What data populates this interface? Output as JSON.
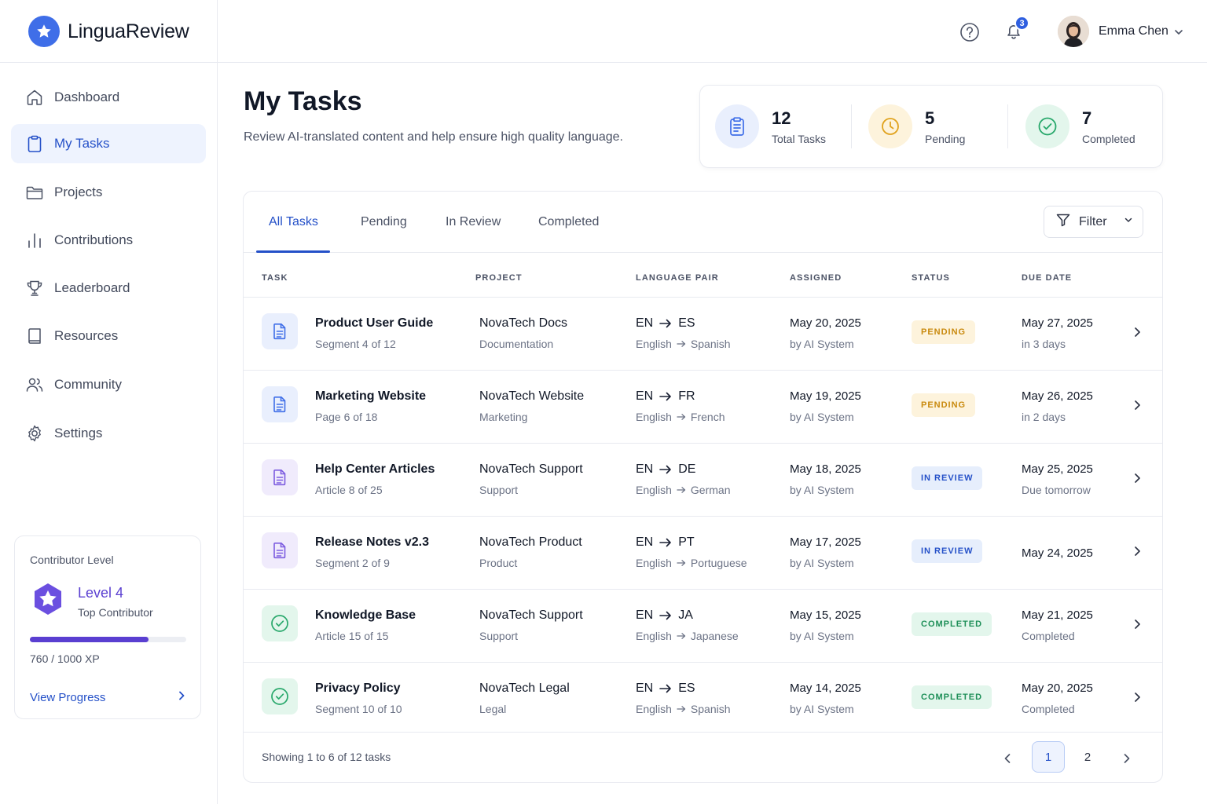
{
  "app": {
    "name": "LinguaReview"
  },
  "header": {
    "notifications_count": "3",
    "user_name": "Emma Chen"
  },
  "sidebar": {
    "items": [
      {
        "label": "Dashboard",
        "icon": "home-icon",
        "active": false
      },
      {
        "label": "My Tasks",
        "icon": "clipboard-icon",
        "active": true
      },
      {
        "label": "Projects",
        "icon": "folder-icon",
        "active": false
      },
      {
        "label": "Contributions",
        "icon": "bar-chart-icon",
        "active": false
      },
      {
        "label": "Leaderboard",
        "icon": "trophy-icon",
        "active": false
      },
      {
        "label": "Resources",
        "icon": "book-icon",
        "active": false
      },
      {
        "label": "Community",
        "icon": "users-icon",
        "active": false
      },
      {
        "label": "Settings",
        "icon": "gear-icon",
        "active": false
      }
    ],
    "level_card": {
      "title": "Contributor Level",
      "level": "Level 4",
      "rank": "Top Contributor",
      "xp_text": "760 / 1000 XP",
      "xp_fraction": 0.76,
      "link": "View Progress"
    }
  },
  "page": {
    "title": "My Tasks",
    "subtitle": "Review AI-translated content and help ensure high quality language."
  },
  "stats": [
    {
      "value": "12",
      "label": "Total Tasks",
      "icon": "clipboard-icon",
      "color": "#3f6ee8",
      "bg": "#e9effd"
    },
    {
      "value": "5",
      "label": "Pending",
      "icon": "clock-icon",
      "color": "#e0a21d",
      "bg": "#fdf3dc"
    },
    {
      "value": "7",
      "label": "Completed",
      "icon": "check-circle-icon",
      "color": "#28a86b",
      "bg": "#e3f6ec"
    }
  ],
  "tabs": [
    {
      "label": "All Tasks",
      "active": true
    },
    {
      "label": "Pending",
      "active": false
    },
    {
      "label": "In Review",
      "active": false
    },
    {
      "label": "Completed",
      "active": false
    }
  ],
  "filter_label": "Filter",
  "table": {
    "columns": [
      "TASK",
      "PROJECT",
      "LANGUAGE PAIR",
      "ASSIGNED",
      "STATUS",
      "DUE DATE"
    ],
    "rows": [
      {
        "task": "Product User Guide",
        "task_sub": "Segment 4 of 12",
        "project": "NovaTech Docs",
        "project_sub": "Documentation",
        "src": "EN",
        "tgt": "ES",
        "src_full": "English",
        "tgt_full": "Spanish",
        "assigned": "May 20, 2025",
        "assigned_by": "by AI System",
        "status": "PENDING",
        "status_type": "pending",
        "due": "May 27, 2025",
        "due_sub": "in 3 days",
        "icon_type": "doc"
      },
      {
        "task": "Marketing Website",
        "task_sub": "Page 6 of 18",
        "project": "NovaTech Website",
        "project_sub": "Marketing",
        "src": "EN",
        "tgt": "FR",
        "src_full": "English",
        "tgt_full": "French",
        "assigned": "May 19, 2025",
        "assigned_by": "by AI System",
        "status": "PENDING",
        "status_type": "pending",
        "due": "May 26, 2025",
        "due_sub": "in 2 days",
        "icon_type": "doc"
      },
      {
        "task": "Help Center Articles",
        "task_sub": "Article 8 of 25",
        "project": "NovaTech Support",
        "project_sub": "Support",
        "src": "EN",
        "tgt": "DE",
        "src_full": "English",
        "tgt_full": "German",
        "assigned": "May 18, 2025",
        "assigned_by": "by AI System",
        "status": "IN REVIEW",
        "status_type": "review",
        "due": "May 25, 2025",
        "due_sub": "Due tomorrow",
        "icon_type": "doc-purple"
      },
      {
        "task": "Release Notes v2.3",
        "task_sub": "Segment 2 of 9",
        "project": "NovaTech Product",
        "project_sub": "Product",
        "src": "EN",
        "tgt": "PT",
        "src_full": "English",
        "tgt_full": "Portuguese",
        "assigned": "May 17, 2025",
        "assigned_by": "by AI System",
        "status": "IN REVIEW",
        "status_type": "review",
        "due": "May 24, 2025",
        "due_sub": "",
        "icon_type": "doc-purple"
      },
      {
        "task": "Knowledge Base",
        "task_sub": "Article 15 of 15",
        "project": "NovaTech Support",
        "project_sub": "Support",
        "src": "EN",
        "tgt": "JA",
        "src_full": "English",
        "tgt_full": "Japanese",
        "assigned": "May 15, 2025",
        "assigned_by": "by AI System",
        "status": "COMPLETED",
        "status_type": "completed",
        "due": "May 21, 2025",
        "due_sub": "Completed",
        "icon_type": "check"
      },
      {
        "task": "Privacy Policy",
        "task_sub": "Segment 10 of 10",
        "project": "NovaTech Legal",
        "project_sub": "Legal",
        "src": "EN",
        "tgt": "ES",
        "src_full": "English",
        "tgt_full": "Spanish",
        "assigned": "May 14, 2025",
        "assigned_by": "by AI System",
        "status": "COMPLETED",
        "status_type": "completed",
        "due": "May 20, 2025",
        "due_sub": "Completed",
        "icon_type": "check"
      }
    ]
  },
  "pagination": {
    "summary": "Showing 1 to 6 of 12 tasks",
    "pages": [
      "1",
      "2"
    ],
    "current": "1"
  }
}
